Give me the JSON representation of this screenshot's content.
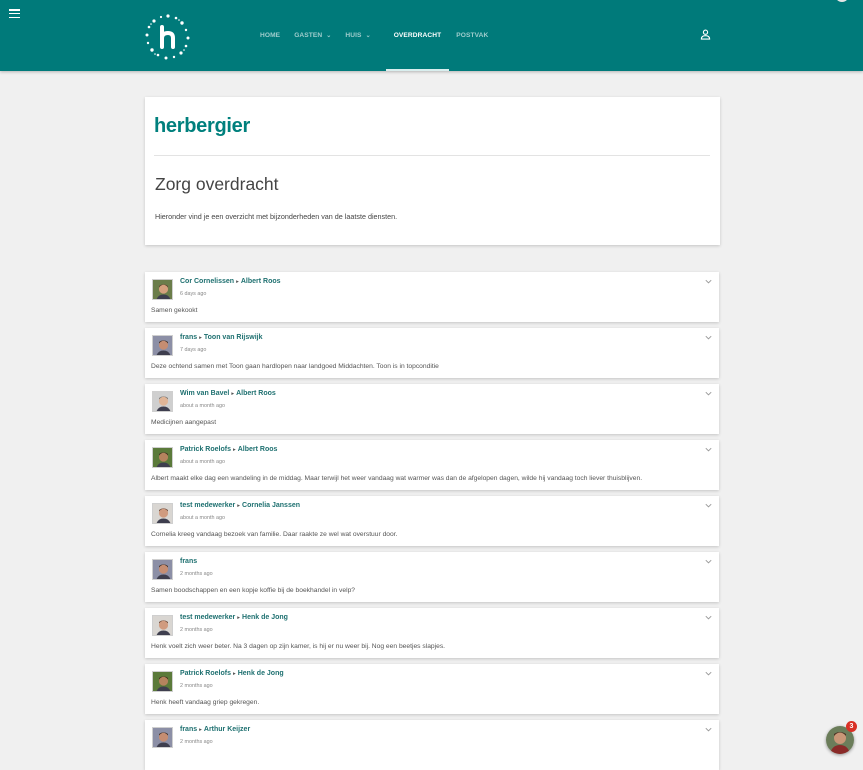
{
  "nav": {
    "items": [
      {
        "label": "HOME",
        "dropdown": false,
        "active": false
      },
      {
        "label": "GASTEN",
        "dropdown": true,
        "active": false
      },
      {
        "label": "HUIS",
        "dropdown": true,
        "active": false
      },
      {
        "label": "OVERDRACHT",
        "dropdown": false,
        "active": true
      },
      {
        "label": "POSTVAK",
        "dropdown": false,
        "active": false
      }
    ],
    "icons": {
      "menu": "hamburger-icon",
      "logo": "h-logo",
      "user": "user-icon"
    }
  },
  "colors": {
    "topbar": "#007a7a",
    "brand": "#00807d",
    "link": "#1e7070",
    "badge": "#d93025"
  },
  "header": {
    "brand": "herbergier",
    "title": "Zorg overdracht",
    "intro": "Hieronder vind je een overzicht met bijzonderheden van de laatste diensten."
  },
  "entries": [
    {
      "author": "Cor Cornelissen",
      "recipient": "Albert Roos",
      "time": "6 days ago",
      "text": "Samen gekookt"
    },
    {
      "author": "frans",
      "recipient": "Toon van Rijswijk",
      "time": "7 days ago",
      "text": "Deze ochtend samen met Toon gaan hardlopen naar landgoed Middachten. Toon is in topconditie"
    },
    {
      "author": "Wim van Bavel",
      "recipient": "Albert Roos",
      "time": "about a month ago",
      "text": "Medicijnen aangepast"
    },
    {
      "author": "Patrick Roelofs",
      "recipient": "Albert Roos",
      "time": "about a month ago",
      "text": "Albert maakt elke dag een wandeling in de middag. Maar terwijl het weer vandaag wat warmer was dan de afgelopen dagen, wilde hij vandaag toch liever thuisblijven."
    },
    {
      "author": "test medewerker",
      "recipient": "Cornelia Janssen",
      "time": "about a month ago",
      "text": "Cornelia kreeg vandaag bezoek van familie. Daar raakte ze wel wat overstuur door."
    },
    {
      "author": "frans",
      "recipient": "",
      "time": "2 months ago",
      "text": "Samen boodschappen en een kopje koffie bij de boekhandel in velp?"
    },
    {
      "author": "test medewerker",
      "recipient": "Henk de Jong",
      "time": "2 months ago",
      "text": "Henk voelt zich weer beter. Na 3 dagen op zijn kamer, is hij er nu weer bij. Nog een beetjes slapjes."
    },
    {
      "author": "Patrick Roelofs",
      "recipient": "Henk de Jong",
      "time": "2 months ago",
      "text": "Henk heeft vandaag griep gekregen."
    },
    {
      "author": "frans",
      "recipient": "Arthur Keijzer",
      "time": "2 months ago",
      "text": ""
    }
  ],
  "chat": {
    "badge_count": "3"
  }
}
